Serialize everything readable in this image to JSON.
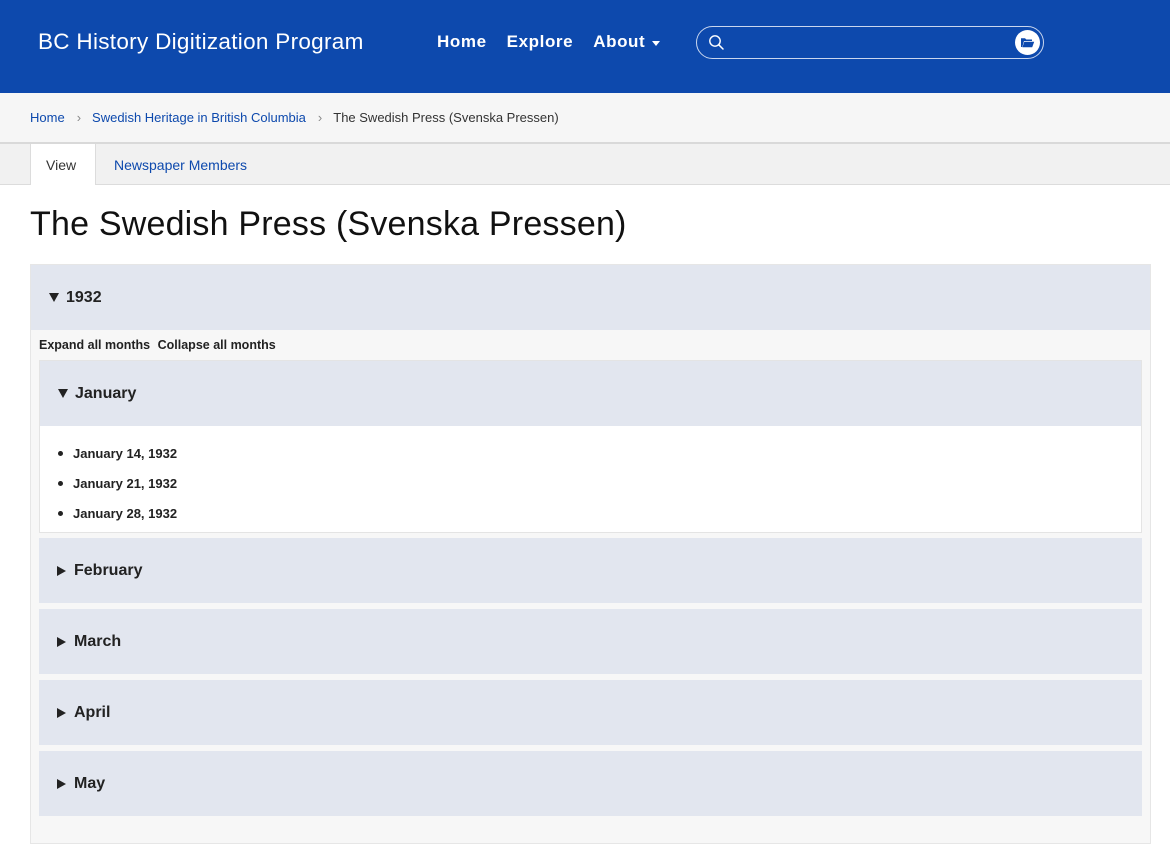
{
  "header": {
    "site_title": "BC History Digitization Program",
    "nav": {
      "home": "Home",
      "explore": "Explore",
      "about": "About"
    },
    "search": {
      "placeholder": ""
    },
    "brand_color": "#0d49ad"
  },
  "breadcrumb": {
    "items": [
      "Home",
      "Swedish Heritage in British Columbia",
      "The Swedish Press (Svenska Pressen)"
    ]
  },
  "tabs": [
    {
      "label": "View",
      "active": true
    },
    {
      "label": "Newspaper Members",
      "active": false
    }
  ],
  "page": {
    "title": "The Swedish Press (Svenska Pressen)",
    "year": "1932",
    "expand_all": "Expand all months",
    "collapse_all": "Collapse all months",
    "months": [
      {
        "label": "January",
        "expanded": true,
        "issues": [
          "January 14, 1932",
          "January 21, 1932",
          "January 28, 1932"
        ]
      },
      {
        "label": "February",
        "expanded": false
      },
      {
        "label": "March",
        "expanded": false
      },
      {
        "label": "April",
        "expanded": false
      },
      {
        "label": "May",
        "expanded": false
      }
    ]
  }
}
